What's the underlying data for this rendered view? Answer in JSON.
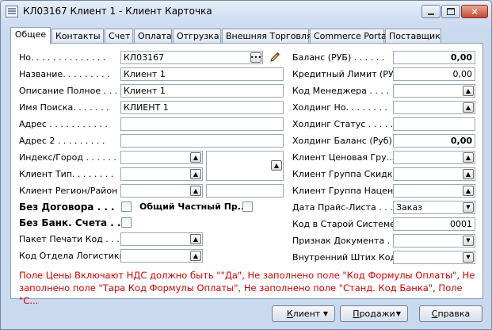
{
  "window": {
    "title": "КЛ03167 Клиент 1 - Клиент Карточка"
  },
  "tabs": [
    {
      "label": "Общее"
    },
    {
      "label": "Контакты"
    },
    {
      "label": "Счет"
    },
    {
      "label": "Оплата"
    },
    {
      "label": "Отгрузка"
    },
    {
      "label": "Внешняя Торговля"
    },
    {
      "label": "Commerce Portal"
    },
    {
      "label": "Поставщик"
    }
  ],
  "left": {
    "no_label": "Но. . . . . . . . . . . . . .",
    "no_value": "КЛ03167",
    "name_label": "Название. . . . . . . . .",
    "name_value": "Клиент 1",
    "fulldesc_label": "Описание Полное . . .",
    "fulldesc_value": "Клиент 1",
    "search_label": "Имя Поиска. . . . . . .",
    "search_value": "КЛИЕНТ 1",
    "address_label": "Адрес . . . . . . . . . . .",
    "address_value": "",
    "address2_label": "Адрес 2 . . . . . . . . .",
    "address2_value": "",
    "postcode_label": "Индекс/Город . . . . . .",
    "clienttype_label": "Клиент Тип. . . . . . . .",
    "region_label": "Клиент Регион/Район . .",
    "nocontract_label": "Без Договора . . .",
    "common_private_label": "Общий Частный Пр...",
    "nobank_label": "Без Банк. Счета . .",
    "print_package_label": "Пакет Печати Код . . .",
    "logistics_label": "Код Отдела Логистики. ."
  },
  "right": {
    "balance_label": "Баланс (РУБ) . . . . . .",
    "balance_value": "0,00",
    "credit_label": "Кредитный Лимит (РУБ)",
    "credit_value": "0,00",
    "manager_label": "Код Менеджера . . . .",
    "holding_no_label": "Холдинг Но. . . . . . . .",
    "holding_status_label": "Холдинг Статус . . . . .",
    "holding_balance_label": "Холдинг Баланс (Руб)",
    "holding_balance_value": "0,00",
    "price_group_label": "Клиент Ценовая Гру...",
    "discount_group_label": "Клиент Группа Скидки. .",
    "markup_group_label": "Клиент Группа Наценки",
    "pricelist_date_label": "Дата Прайс-Листа . . .",
    "pricelist_date_value": "Заказ",
    "old_system_label": "Код в Старой Системе. .",
    "old_system_value": "0001",
    "doc_flag_label": "Признак Документа . . .",
    "barcode_label": "Внутренний Штих Код . ."
  },
  "message": "Поле Цены Включают НДС должно быть \"\"Да\", Не заполнено поле \"Код Формулы Оплаты\", Не заполнено поле \"Тара Код Формулы Оплаты\", Не заполнено поле \"Станд. Код Банка\", Поле \"С...",
  "buttons": {
    "client": "Клиент",
    "sales": "Продажи",
    "help": "Справка"
  },
  "colors": {
    "error_text": "#d40000",
    "window_bg": "#c9d9ee"
  }
}
